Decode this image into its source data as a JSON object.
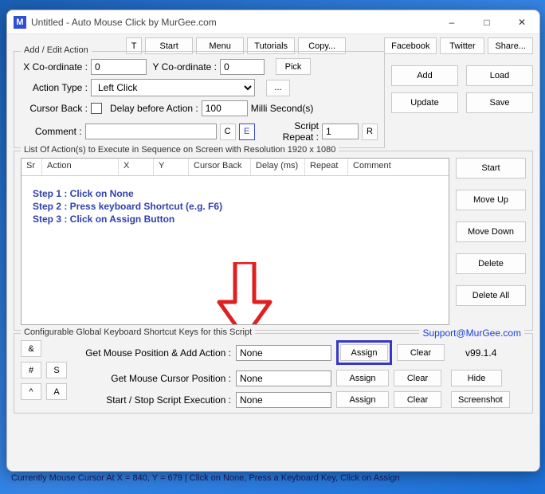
{
  "window": {
    "title": "Untitled - Auto Mouse Click by MurGee.com",
    "icon_letter": "M"
  },
  "toolbar": {
    "t": "T",
    "start": "Start",
    "menu": "Menu",
    "tutorials": "Tutorials",
    "copy": "Copy...",
    "facebook": "Facebook",
    "twitter": "Twitter",
    "share": "Share..."
  },
  "addEdit": {
    "title": "Add / Edit Action",
    "xcoord_lbl": "X Co-ordinate :",
    "xcoord": "0",
    "ycoord_lbl": "Y Co-ordinate :",
    "ycoord": "0",
    "pick": "Pick",
    "action_type_lbl": "Action Type :",
    "action_type": "Left Click",
    "more": "...",
    "cursor_back_lbl": "Cursor Back :",
    "delay_lbl": "Delay before Action :",
    "delay": "100",
    "delay_unit": "Milli Second(s)",
    "comment_lbl": "Comment :",
    "comment": "",
    "c": "C",
    "e": "E",
    "script_repeat_lbl": "Script Repeat :",
    "script_repeat": "1",
    "r": "R"
  },
  "rightButtons": {
    "add": "Add",
    "load": "Load",
    "update": "Update",
    "save": "Save"
  },
  "list": {
    "title": "List Of Action(s) to Execute in Sequence on Screen with Resolution 1920 x 1080",
    "cols": {
      "sr": "Sr",
      "action": "Action",
      "x": "X",
      "y": "Y",
      "cursor_back": "Cursor Back",
      "delay": "Delay (ms)",
      "repeat": "Repeat",
      "comment": "Comment"
    }
  },
  "listButtons": {
    "start": "Start",
    "move_up": "Move Up",
    "move_down": "Move Down",
    "delete": "Delete",
    "delete_all": "Delete All"
  },
  "tutorial": {
    "step1": "Step 1 : Click on None",
    "step2": "Step 2 : Press keyboard Shortcut (e.g. F6)",
    "step3": "Step 3 : Click on Assign Button"
  },
  "shortcuts": {
    "title": "Configurable Global Keyboard Shortcut Keys for this Script",
    "support": "Support@MurGee.com",
    "row1_lbl": "Get Mouse Position & Add Action :",
    "row1_val": "None",
    "assign": "Assign",
    "clear": "Clear",
    "version": "v99.1.4",
    "row2_lbl": "Get Mouse Cursor Position :",
    "row2_val": "None",
    "hide": "Hide",
    "row3_lbl": "Start / Stop Script Execution :",
    "row3_val": "None",
    "screenshot": "Screenshot",
    "keys": {
      "amp": "&",
      "hash": "#",
      "s": "S",
      "up": "^",
      "a": "A"
    }
  },
  "status": "Currently Mouse Cursor At X = 840, Y = 679 | Click on None, Press a Keyboard Key, Click on Assign"
}
